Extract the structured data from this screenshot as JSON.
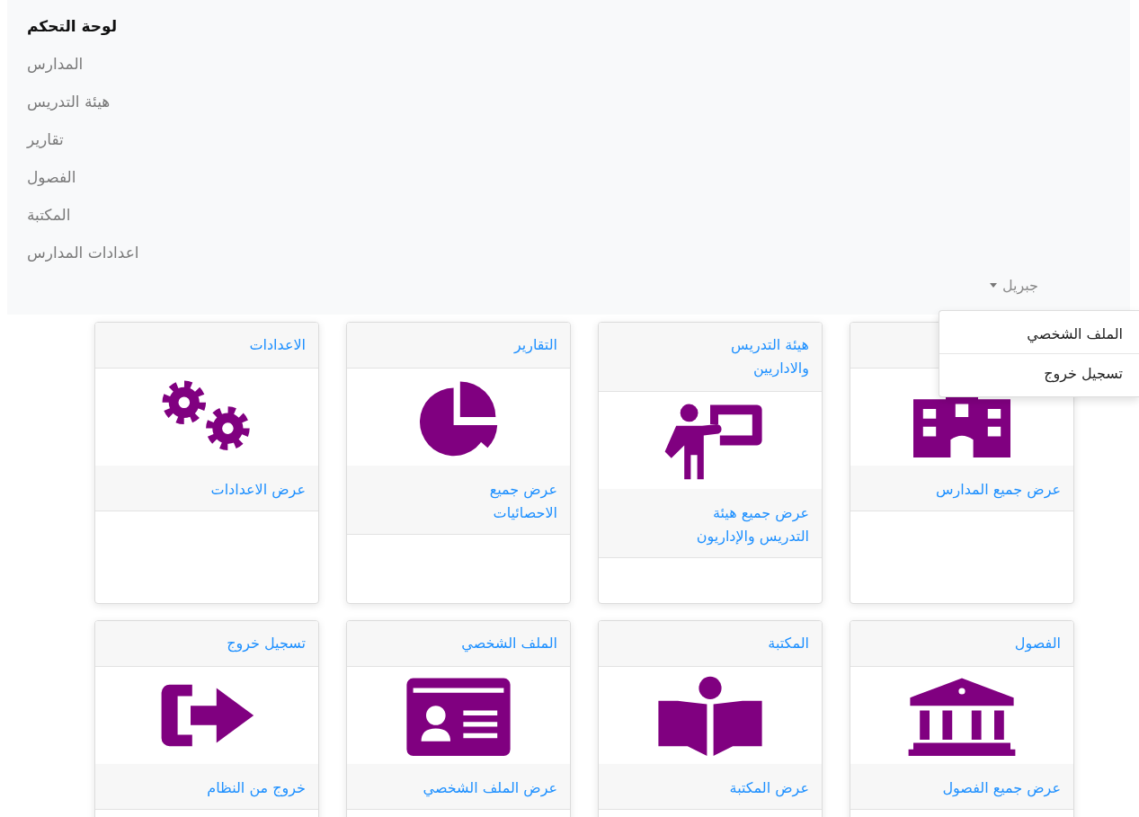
{
  "nav": {
    "items": [
      {
        "label": "لوحة التحكم",
        "selected": true
      },
      {
        "label": "المدارس",
        "selected": false
      },
      {
        "label": "هيئة التدريس",
        "selected": false
      },
      {
        "label": "تقارير",
        "selected": false
      },
      {
        "label": "الفصول",
        "selected": false
      },
      {
        "label": "المكتبة",
        "selected": false
      },
      {
        "label": "اعدادات المدارس",
        "selected": false
      }
    ]
  },
  "user_menu": {
    "name": "جبريل",
    "expanded": true,
    "items": [
      "الملف الشخصي",
      "تسجيل خروج"
    ]
  },
  "cards": [
    {
      "link": "عرض جميع المدارس"
    },
    {
      "title": "هيئة التدريس والاداريين",
      "link": "عرض جميع هيئة التدريس والإداريون"
    },
    {
      "title": "التقارير",
      "link": "عرض جميع الاحصائيات"
    },
    {
      "title": "الاعدادات",
      "link": "عرض الاعدادات"
    },
    {
      "title": "الفصول",
      "link": "عرض جميع الفصول"
    },
    {
      "title": "المكتبة",
      "link": "عرض المكتبة"
    },
    {
      "title": "الملف الشخصي",
      "link": "عرض الملف الشخصي"
    },
    {
      "title": "تسجيل خروج",
      "link": "خروج من النظام"
    }
  ]
}
